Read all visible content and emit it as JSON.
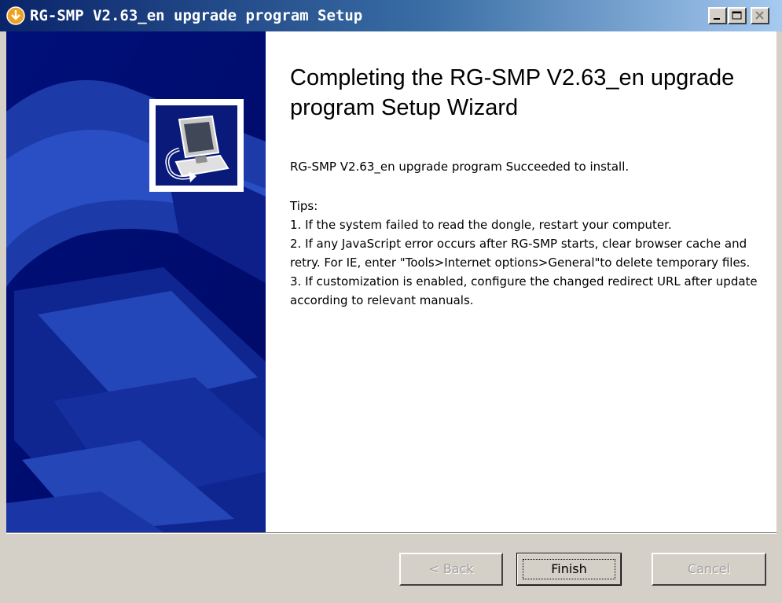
{
  "window": {
    "title": "RG-SMP V2.63_en upgrade program Setup",
    "app_icon": "installer-icon",
    "controls": [
      "minimize-icon",
      "maximize-icon",
      "close-icon"
    ]
  },
  "banner": {
    "logo_icon": "computer-install-icon"
  },
  "content": {
    "heading": "Completing the RG-SMP V2.63_en upgrade program Setup Wizard",
    "success_message": "RG-SMP V2.63_en upgrade program Succeeded to install.",
    "tips_title": "Tips:",
    "tips": [
      "1. If the system failed to read the dongle, restart your computer.",
      "2. If any JavaScript error occurs after RG-SMP starts, clear browser cache and retry. For IE, enter \"Tools>Internet options>General\"to delete temporary files.",
      "3. If customization is enabled, configure the changed redirect URL after update according to relevant manuals."
    ]
  },
  "buttons": {
    "back": "< Back",
    "finish": "Finish",
    "cancel": "Cancel"
  },
  "colors": {
    "title_bar": "#0a246a",
    "banner": "#000e78",
    "face": "#d4d0c8"
  }
}
